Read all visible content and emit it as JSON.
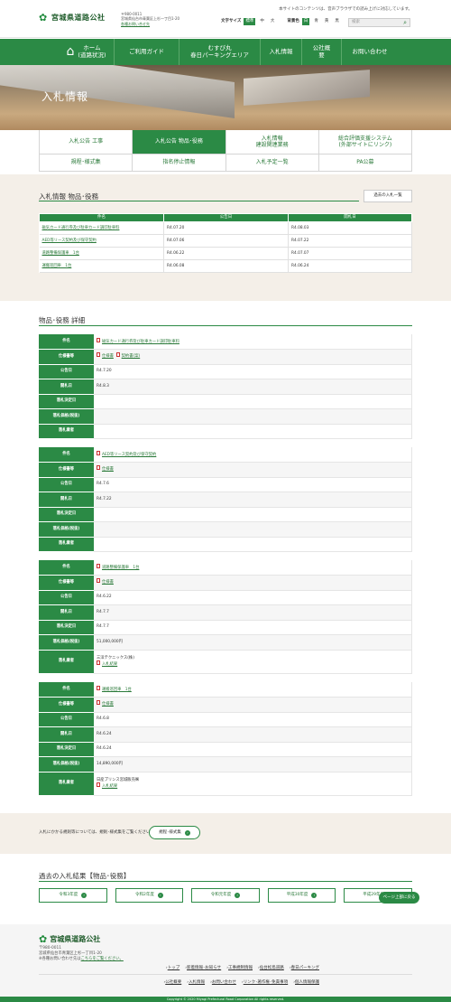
{
  "header": {
    "logo_text": "宮城県道路公社",
    "postal": "〒980-0011",
    "address": "宮城県仙台市青葉区上杉一丁目1-20",
    "inquiry_link": "各種お問い合せ先",
    "notice": "本サイトのコンテンツは、音声ブラウザでの読み上げに対応しています。",
    "font_size_label": "文字サイズ",
    "font_sizes": [
      "標準",
      "中",
      "大"
    ],
    "bg_color_label": "背景色",
    "bg_colors": [
      "白",
      "青",
      "黄",
      "黒"
    ],
    "search_placeholder": "検索"
  },
  "nav": {
    "home": "ホーム\n(道路状況)",
    "items": [
      "ご利用ガイド",
      "むすび丸\n春日パーキングエリア",
      "入札情報",
      "公社概要",
      "お問い合わせ"
    ]
  },
  "hero_title": "入札情報",
  "tabs": {
    "row1": [
      "入札公告 工事",
      "入札公告 物品･役務",
      "入札情報\n建設関連業務",
      "総合評価支援システム\n(外部サイトにリンク)"
    ],
    "row2": [
      "規程･様式集",
      "指名停止情報",
      "入札予定一覧",
      "PA公募"
    ]
  },
  "list_section": {
    "title": "入札情報 物品･役務",
    "past_button": "過去の入札一覧",
    "headers": [
      "件名",
      "公告日",
      "開札日"
    ],
    "rows": [
      [
        "磁気カード通行券及び駐車カード調印駐車料",
        "R4.07.20",
        "R4.08.03"
      ],
      [
        "AED等リース契約及び保守契約",
        "R4.07.06",
        "R4.07.22"
      ],
      [
        "道路整備保護車　1台",
        "R4.06.22",
        "R4.07.07"
      ],
      [
        "運搬巡回車　1台",
        "R4.06.08",
        "R4.06.24"
      ]
    ]
  },
  "detail_section": {
    "title": "物品･役務 詳細",
    "labels": [
      "件名",
      "仕様書等",
      "公告日",
      "開札日",
      "落札決定日",
      "落札価格(税抜)",
      "落札業者"
    ],
    "spec_links": [
      "仕様書",
      "契約書(案)"
    ],
    "results_link": "入札結果",
    "items": [
      {
        "name": "磁気カード通行券及び駐車カード調印駐車料",
        "specs": [
          "仕様書",
          "契約書(案)"
        ],
        "announce": "R4.7.20",
        "open": "R4.8.3",
        "decided": "",
        "price": "",
        "winner": ""
      },
      {
        "name": "AED等リース契約及び保守契約",
        "specs": [
          "仕様書"
        ],
        "announce": "R4.7.6",
        "open": "R4.7.22",
        "decided": "",
        "price": "",
        "winner": ""
      },
      {
        "name": "道路整備保護車　1台",
        "specs": [
          "仕様書"
        ],
        "announce": "R4.6.22",
        "open": "R4.7.7",
        "decided": "R4.7.7",
        "price": "51,000,000円",
        "winner": "三洋テクニックス(株)"
      },
      {
        "name": "運搬巡回車　1台",
        "specs": [
          "仕様書"
        ],
        "announce": "R4.6.8",
        "open": "R4.6.24",
        "decided": "R4.6.24",
        "price": "14,890,000円",
        "winner": "日産プリンス宮城販売㈱"
      }
    ]
  },
  "rules_section": {
    "text": "入札にかかる規則等については、規則･様式集をご覧ください。",
    "button": "規程･様式集"
  },
  "past_results": {
    "title": "過去の入札結果【物品･役務】",
    "years": [
      "令和3年度",
      "令和2年度",
      "令和元年度",
      "平成30年度",
      "平成29年度"
    ],
    "page_top": "ページ上部に戻る"
  },
  "footer": {
    "logo_text": "宮城県道路公社",
    "postal": "〒980-0011",
    "address": "宮城県仙台市青葉区上杉一丁目1-20",
    "contact_prefix": "※各種お問い合わせ先は",
    "contact_link": "こちらをご覧ください。",
    "links_row1": [
      "トップ",
      "新着情報･お知らせ",
      "工事規制情報",
      "仙台松島道路",
      "春日パーキング"
    ],
    "links_row2": [
      "公社概要",
      "入札情報",
      "お問い合わせ",
      "リンク･著作権･免責事項",
      "個人情報保護"
    ],
    "copyright": "Copyright © 2020 Miyagi Prefectural Road Corporation All rights reserved."
  }
}
